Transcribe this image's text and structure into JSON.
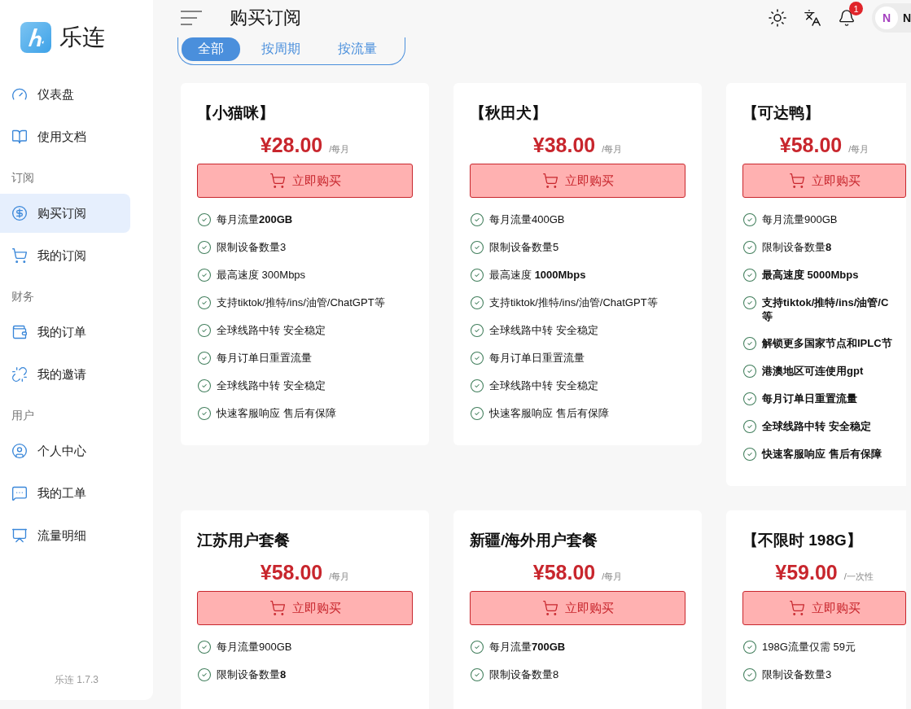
{
  "brand": {
    "name": "乐连"
  },
  "sidebar": {
    "groups": [
      {
        "items": [
          {
            "label": "仪表盘",
            "selected": false
          },
          {
            "label": "使用文档",
            "selected": false
          }
        ]
      },
      {
        "heading": "订阅",
        "items": [
          {
            "label": "购买订阅",
            "selected": true
          },
          {
            "label": "我的订阅",
            "selected": false
          }
        ]
      },
      {
        "heading": "财务",
        "items": [
          {
            "label": "我的订单",
            "selected": false
          },
          {
            "label": "我的邀请",
            "selected": false
          }
        ]
      },
      {
        "heading": "用户",
        "items": [
          {
            "label": "个人中心",
            "selected": false
          },
          {
            "label": "我的工单",
            "selected": false
          },
          {
            "label": "流量明细",
            "selected": false
          }
        ]
      }
    ],
    "version": "乐连 1.7.3"
  },
  "header": {
    "title": "购买订阅",
    "notifications": "1",
    "avatar": "N",
    "user": "N"
  },
  "filter_tabs": [
    {
      "label": "全部",
      "selected": true
    },
    {
      "label": "按周期",
      "selected": false
    },
    {
      "label": "按流量",
      "selected": false
    }
  ],
  "plans": [
    {
      "name": "【小猫咪】",
      "price": "¥28.00",
      "period": "/每月",
      "button": "立即购买",
      "features": [
        {
          "text": "每月流量**200GB**",
          "bold": false
        },
        {
          "text": "限制设备数量3",
          "bold": false
        },
        {
          "text": "最高速度 300Mbps",
          "bold": false
        },
        {
          "text": "支持tiktok/推特/ins/油管/ChatGPT等",
          "bold": false
        },
        {
          "text": "全球线路中转 安全稳定",
          "bold": false
        },
        {
          "text": "每月订单日重置流量",
          "bold": false
        },
        {
          "text": "全球线路中转 安全稳定",
          "bold": false
        },
        {
          "text": "快速客服响应 售后有保障",
          "bold": false
        }
      ]
    },
    {
      "name": "【秋田犬】",
      "price": "¥38.00",
      "period": "/每月",
      "button": "立即购买",
      "features": [
        {
          "text": "每月流量400GB",
          "bold": false
        },
        {
          "text": "限制设备数量5",
          "bold": false
        },
        {
          "text": "最高速度 **1000Mbps**",
          "bold": false
        },
        {
          "text": "支持tiktok/推特/ins/油管/ChatGPT等",
          "bold": false
        },
        {
          "text": "全球线路中转 安全稳定",
          "bold": false
        },
        {
          "text": "每月订单日重置流量",
          "bold": false
        },
        {
          "text": "全球线路中转 安全稳定",
          "bold": false
        },
        {
          "text": "快速客服响应 售后有保障",
          "bold": false
        }
      ]
    },
    {
      "name": "【可达鸭】",
      "price": "¥58.00",
      "period": "/每月",
      "button": "立即购买",
      "features": [
        {
          "text": "每月流量900GB",
          "bold": false
        },
        {
          "text": "限制设备数量**8**",
          "bold": false
        },
        {
          "text": "最高速度 5000Mbps",
          "bold": true
        },
        {
          "text": "支持tiktok/推特/ins/油管/C\n等",
          "bold": true
        },
        {
          "text": "解锁更多国家节点和IPLC节",
          "bold": true
        },
        {
          "text": "港澳地区可连使用gpt",
          "bold": true
        },
        {
          "text": "每月订单日重置流量",
          "bold": true
        },
        {
          "text": "全球线路中转 安全稳定",
          "bold": true
        },
        {
          "text": "快速客服响应 售后有保障",
          "bold": true
        }
      ]
    },
    {
      "name": "江苏用户套餐",
      "price": "¥58.00",
      "period": "/每月",
      "button": "立即购买",
      "features": [
        {
          "text": "每月流量900GB",
          "bold": false
        },
        {
          "text": "限制设备数量**8**",
          "bold": false
        }
      ]
    },
    {
      "name": "新疆/海外用户套餐",
      "price": "¥58.00",
      "period": "/每月",
      "button": "立即购买",
      "features": [
        {
          "text": "每月流量**700GB**",
          "bold": false
        },
        {
          "text": "限制设备数量8",
          "bold": false
        }
      ]
    },
    {
      "name": "【不限时 198G】",
      "price": "¥59.00",
      "period": "/一次性",
      "button": "立即购买",
      "features": [
        {
          "text": "198G流量仅需 59元",
          "bold": false
        },
        {
          "text": "限制设备数量3",
          "bold": false
        }
      ]
    }
  ]
}
